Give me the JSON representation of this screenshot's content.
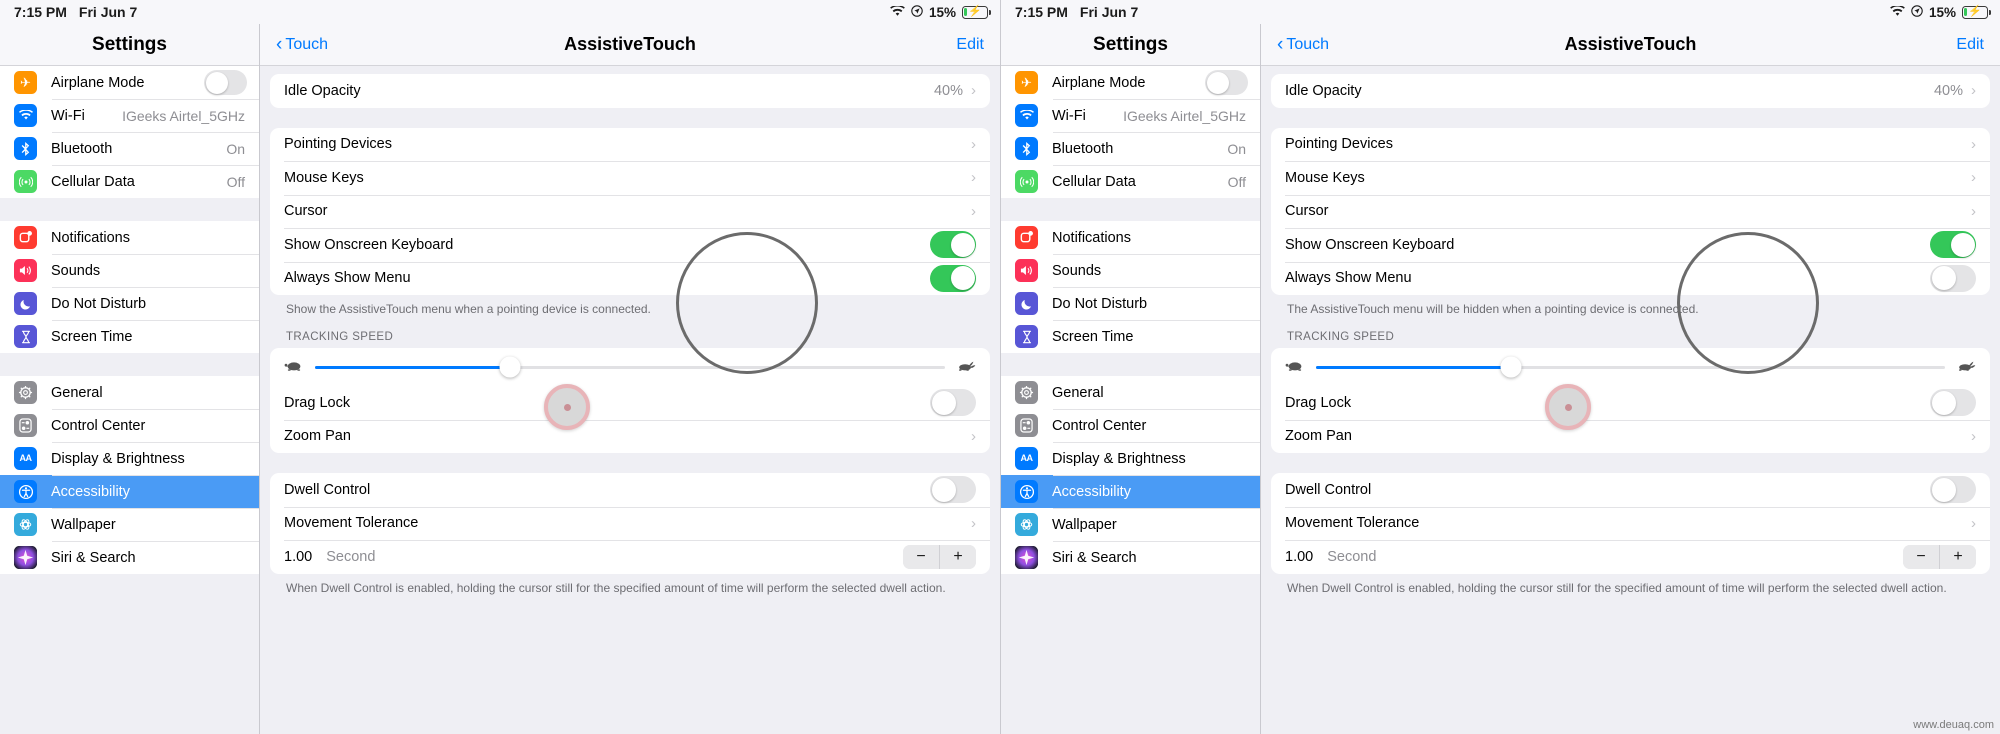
{
  "status_bar": {
    "time": "7:15 PM",
    "date": "Fri Jun 7",
    "wifi_icon": "wifi-icon",
    "location_icon": "location-icon",
    "battery_percent": "15%",
    "battery_level": 15,
    "charging": true
  },
  "sidebar": {
    "title": "Settings",
    "groups": [
      {
        "items": [
          {
            "label": "Airplane Mode",
            "icon": "airplane-icon",
            "icon_color": "#ff9500",
            "control": "toggle",
            "toggle_on": false
          },
          {
            "label": "Wi-Fi",
            "icon": "wifi-icon",
            "icon_color": "#007aff",
            "value": "IGeeks Airtel_5GHz"
          },
          {
            "label": "Bluetooth",
            "icon": "bluetooth-icon",
            "icon_color": "#007aff",
            "value": "On"
          },
          {
            "label": "Cellular Data",
            "icon": "cellular-icon",
            "icon_color": "#4cd964",
            "value": "Off"
          }
        ]
      },
      {
        "items": [
          {
            "label": "Notifications",
            "icon": "notifications-icon",
            "icon_color": "#ff3b30"
          },
          {
            "label": "Sounds",
            "icon": "sounds-icon",
            "icon_color": "#fc3158"
          },
          {
            "label": "Do Not Disturb",
            "icon": "moon-icon",
            "icon_color": "#5856d6"
          },
          {
            "label": "Screen Time",
            "icon": "hourglass-icon",
            "icon_color": "#5856d6"
          }
        ]
      },
      {
        "items": [
          {
            "label": "General",
            "icon": "gear-icon",
            "icon_color": "#8e8e93"
          },
          {
            "label": "Control Center",
            "icon": "control-center-icon",
            "icon_color": "#8e8e93"
          },
          {
            "label": "Display & Brightness",
            "icon": "display-brightness-icon",
            "icon_color": "#007aff"
          },
          {
            "label": "Accessibility",
            "icon": "accessibility-icon",
            "icon_color": "#007aff",
            "selected": true
          },
          {
            "label": "Wallpaper",
            "icon": "wallpaper-icon",
            "icon_color": "#34aadc"
          },
          {
            "label": "Siri & Search",
            "icon": "siri-icon",
            "icon_color": "#1b1b1f"
          }
        ]
      }
    ]
  },
  "detail": {
    "back_label": "Touch",
    "title": "AssistiveTouch",
    "edit_label": "Edit",
    "idle_opacity": {
      "label": "Idle Opacity",
      "value": "40%"
    },
    "pointer_rows": [
      {
        "label": "Pointing Devices"
      },
      {
        "label": "Mouse Keys"
      },
      {
        "label": "Cursor"
      }
    ],
    "show_onscreen_keyboard": {
      "label": "Show Onscreen Keyboard",
      "toggle_on": true
    },
    "always_show_menu": {
      "label": "Always Show Menu"
    },
    "tracking_speed": {
      "header": "TRACKING SPEED",
      "slow_icon": "tortoise-icon",
      "fast_icon": "hare-icon",
      "percent": 31
    },
    "drag_lock": {
      "label": "Drag Lock",
      "toggle_on": false
    },
    "zoom_pan": {
      "label": "Zoom Pan"
    },
    "dwell_control": {
      "label": "Dwell Control",
      "toggle_on": false
    },
    "movement_tolerance": {
      "label": "Movement Tolerance"
    },
    "dwell_seconds": {
      "value": "1.00",
      "unit": "Second",
      "minus": "−",
      "plus": "+"
    },
    "dwell_note": "When Dwell Control is enabled, holding the cursor still for the specified amount of time will perform the selected dwell action."
  },
  "left_panel": {
    "always_show_menu_toggle_on": true,
    "always_show_menu_note": "Show the AssistiveTouch menu when a pointing device is connected."
  },
  "right_panel": {
    "always_show_menu_toggle_on": false,
    "always_show_menu_note": "The AssistiveTouch menu will be hidden when a pointing device is connected."
  },
  "watermark": "www.deuaq.com",
  "colors": {
    "accent": "#007aff",
    "toggle_on": "#34c759",
    "selected_row": "#4a9bf5",
    "group_background": "#efeff4",
    "annotation_ring": "#6b6b6b",
    "pointer_ring": "#e8b4b8"
  }
}
